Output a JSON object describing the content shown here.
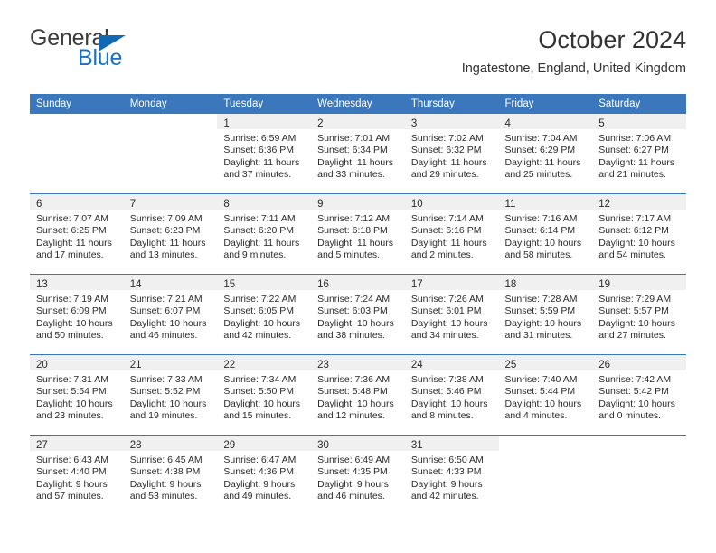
{
  "brand": {
    "name_top": "General",
    "name_bottom": "Blue",
    "flag_icon": "blue-triangle-flag",
    "color_top": "#3c3c3c",
    "color_bottom": "#1d6fc0"
  },
  "header": {
    "title": "October 2024",
    "subtitle": "Ingatestone, England, United Kingdom"
  },
  "theme": {
    "header_blue": "#3b77bd",
    "daynum_band": "#f0f0f0",
    "text": "#2a2a2a"
  },
  "weekdays": [
    "Sunday",
    "Monday",
    "Tuesday",
    "Wednesday",
    "Thursday",
    "Friday",
    "Saturday"
  ],
  "weeks": [
    [
      {
        "day": "",
        "lines": []
      },
      {
        "day": "",
        "lines": []
      },
      {
        "day": "1",
        "lines": [
          "Sunrise: 6:59 AM",
          "Sunset: 6:36 PM",
          "Daylight: 11 hours",
          "and 37 minutes."
        ]
      },
      {
        "day": "2",
        "lines": [
          "Sunrise: 7:01 AM",
          "Sunset: 6:34 PM",
          "Daylight: 11 hours",
          "and 33 minutes."
        ]
      },
      {
        "day": "3",
        "lines": [
          "Sunrise: 7:02 AM",
          "Sunset: 6:32 PM",
          "Daylight: 11 hours",
          "and 29 minutes."
        ]
      },
      {
        "day": "4",
        "lines": [
          "Sunrise: 7:04 AM",
          "Sunset: 6:29 PM",
          "Daylight: 11 hours",
          "and 25 minutes."
        ]
      },
      {
        "day": "5",
        "lines": [
          "Sunrise: 7:06 AM",
          "Sunset: 6:27 PM",
          "Daylight: 11 hours",
          "and 21 minutes."
        ]
      }
    ],
    [
      {
        "day": "6",
        "lines": [
          "Sunrise: 7:07 AM",
          "Sunset: 6:25 PM",
          "Daylight: 11 hours",
          "and 17 minutes."
        ]
      },
      {
        "day": "7",
        "lines": [
          "Sunrise: 7:09 AM",
          "Sunset: 6:23 PM",
          "Daylight: 11 hours",
          "and 13 minutes."
        ]
      },
      {
        "day": "8",
        "lines": [
          "Sunrise: 7:11 AM",
          "Sunset: 6:20 PM",
          "Daylight: 11 hours",
          "and 9 minutes."
        ]
      },
      {
        "day": "9",
        "lines": [
          "Sunrise: 7:12 AM",
          "Sunset: 6:18 PM",
          "Daylight: 11 hours",
          "and 5 minutes."
        ]
      },
      {
        "day": "10",
        "lines": [
          "Sunrise: 7:14 AM",
          "Sunset: 6:16 PM",
          "Daylight: 11 hours",
          "and 2 minutes."
        ]
      },
      {
        "day": "11",
        "lines": [
          "Sunrise: 7:16 AM",
          "Sunset: 6:14 PM",
          "Daylight: 10 hours",
          "and 58 minutes."
        ]
      },
      {
        "day": "12",
        "lines": [
          "Sunrise: 7:17 AM",
          "Sunset: 6:12 PM",
          "Daylight: 10 hours",
          "and 54 minutes."
        ]
      }
    ],
    [
      {
        "day": "13",
        "lines": [
          "Sunrise: 7:19 AM",
          "Sunset: 6:09 PM",
          "Daylight: 10 hours",
          "and 50 minutes."
        ]
      },
      {
        "day": "14",
        "lines": [
          "Sunrise: 7:21 AM",
          "Sunset: 6:07 PM",
          "Daylight: 10 hours",
          "and 46 minutes."
        ]
      },
      {
        "day": "15",
        "lines": [
          "Sunrise: 7:22 AM",
          "Sunset: 6:05 PM",
          "Daylight: 10 hours",
          "and 42 minutes."
        ]
      },
      {
        "day": "16",
        "lines": [
          "Sunrise: 7:24 AM",
          "Sunset: 6:03 PM",
          "Daylight: 10 hours",
          "and 38 minutes."
        ]
      },
      {
        "day": "17",
        "lines": [
          "Sunrise: 7:26 AM",
          "Sunset: 6:01 PM",
          "Daylight: 10 hours",
          "and 34 minutes."
        ]
      },
      {
        "day": "18",
        "lines": [
          "Sunrise: 7:28 AM",
          "Sunset: 5:59 PM",
          "Daylight: 10 hours",
          "and 31 minutes."
        ]
      },
      {
        "day": "19",
        "lines": [
          "Sunrise: 7:29 AM",
          "Sunset: 5:57 PM",
          "Daylight: 10 hours",
          "and 27 minutes."
        ]
      }
    ],
    [
      {
        "day": "20",
        "lines": [
          "Sunrise: 7:31 AM",
          "Sunset: 5:54 PM",
          "Daylight: 10 hours",
          "and 23 minutes."
        ]
      },
      {
        "day": "21",
        "lines": [
          "Sunrise: 7:33 AM",
          "Sunset: 5:52 PM",
          "Daylight: 10 hours",
          "and 19 minutes."
        ]
      },
      {
        "day": "22",
        "lines": [
          "Sunrise: 7:34 AM",
          "Sunset: 5:50 PM",
          "Daylight: 10 hours",
          "and 15 minutes."
        ]
      },
      {
        "day": "23",
        "lines": [
          "Sunrise: 7:36 AM",
          "Sunset: 5:48 PM",
          "Daylight: 10 hours",
          "and 12 minutes."
        ]
      },
      {
        "day": "24",
        "lines": [
          "Sunrise: 7:38 AM",
          "Sunset: 5:46 PM",
          "Daylight: 10 hours",
          "and 8 minutes."
        ]
      },
      {
        "day": "25",
        "lines": [
          "Sunrise: 7:40 AM",
          "Sunset: 5:44 PM",
          "Daylight: 10 hours",
          "and 4 minutes."
        ]
      },
      {
        "day": "26",
        "lines": [
          "Sunrise: 7:42 AM",
          "Sunset: 5:42 PM",
          "Daylight: 10 hours",
          "and 0 minutes."
        ]
      }
    ],
    [
      {
        "day": "27",
        "lines": [
          "Sunrise: 6:43 AM",
          "Sunset: 4:40 PM",
          "Daylight: 9 hours",
          "and 57 minutes."
        ]
      },
      {
        "day": "28",
        "lines": [
          "Sunrise: 6:45 AM",
          "Sunset: 4:38 PM",
          "Daylight: 9 hours",
          "and 53 minutes."
        ]
      },
      {
        "day": "29",
        "lines": [
          "Sunrise: 6:47 AM",
          "Sunset: 4:36 PM",
          "Daylight: 9 hours",
          "and 49 minutes."
        ]
      },
      {
        "day": "30",
        "lines": [
          "Sunrise: 6:49 AM",
          "Sunset: 4:35 PM",
          "Daylight: 9 hours",
          "and 46 minutes."
        ]
      },
      {
        "day": "31",
        "lines": [
          "Sunrise: 6:50 AM",
          "Sunset: 4:33 PM",
          "Daylight: 9 hours",
          "and 42 minutes."
        ]
      },
      {
        "day": "",
        "lines": []
      },
      {
        "day": "",
        "lines": []
      }
    ]
  ]
}
